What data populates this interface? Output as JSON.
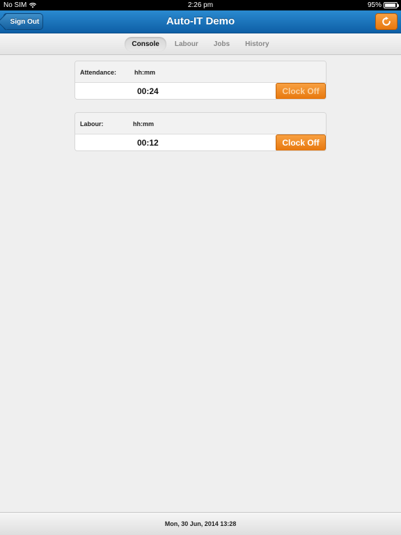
{
  "status_bar": {
    "carrier": "No SIM",
    "wifi_icon": "wifi-icon",
    "time": "2:26 pm",
    "battery_percent": "95%",
    "battery_level": 0.95
  },
  "nav": {
    "title": "Auto-IT Demo",
    "back_label": "Sign Out",
    "refresh_icon": "refresh-icon",
    "accent_color": "#1a73bb",
    "button_color": "#f08a24"
  },
  "tabs": [
    {
      "label": "Console",
      "active": true
    },
    {
      "label": "Labour",
      "active": false
    },
    {
      "label": "Jobs",
      "active": false
    },
    {
      "label": "History",
      "active": false
    }
  ],
  "cards": [
    {
      "label": "Attendance:",
      "unit": "hh:mm",
      "value": "00:24",
      "button_label": "Clock Off"
    },
    {
      "label": "Labour:",
      "unit": "hh:mm",
      "value": "00:12",
      "button_label": "Clock Off"
    }
  ],
  "footer": {
    "datetime": "Mon, 30 Jun, 2014 13:28"
  }
}
